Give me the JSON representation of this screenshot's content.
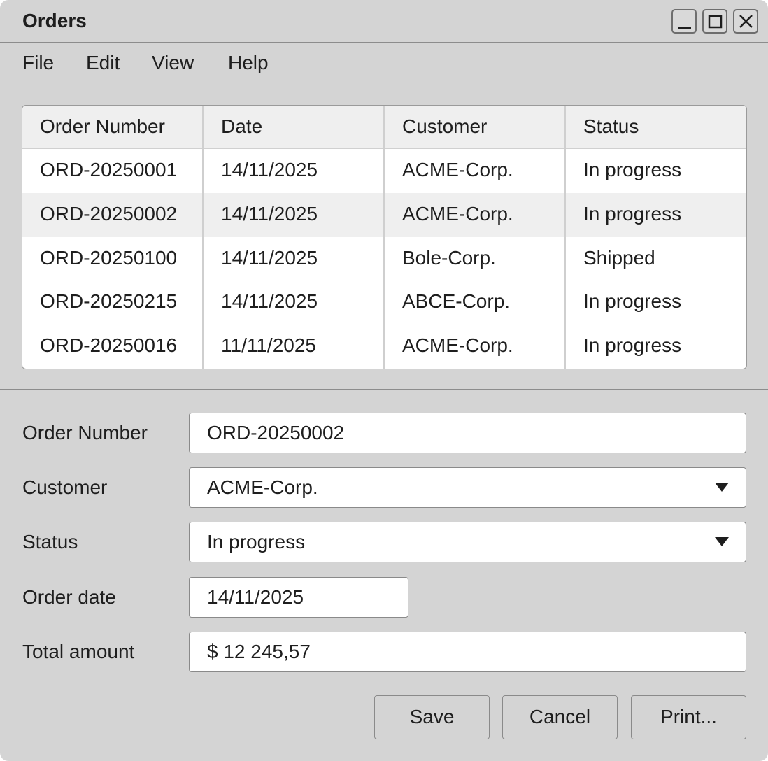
{
  "window": {
    "title": "Orders",
    "controls": [
      "minimize",
      "maximize",
      "close"
    ]
  },
  "menu": {
    "items": [
      "File",
      "Edit",
      "View",
      "Help"
    ]
  },
  "table": {
    "columns": [
      "Order Number",
      "Date",
      "Customer",
      "Status"
    ],
    "rows": [
      [
        "ORD-20250001",
        "14/11/2025",
        "ACME-Corp.",
        "In progress"
      ],
      [
        "ORD-20250002",
        "14/11/2025",
        "ACME-Corp.",
        "In progress"
      ],
      [
        "ORD-20250100",
        "14/11/2025",
        "Bole-Corp.",
        "Shipped"
      ],
      [
        "ORD-20250215",
        "14/11/2025",
        "ABCE-Corp.",
        "In progress"
      ],
      [
        "ORD-20250016",
        "11/11/2025",
        "ACME-Corp.",
        "In progress"
      ]
    ],
    "selected_row": 1
  },
  "form": {
    "order_number": {
      "label": "Order Number",
      "value": "ORD-20250002"
    },
    "customer": {
      "label": "Customer",
      "value": "ACME-Corp."
    },
    "status": {
      "label": "Status",
      "value": "In progress"
    },
    "order_date": {
      "label": "Order date",
      "value": "14/11/2025"
    },
    "total_amount": {
      "label": "Total amount",
      "value": "$ 12 245,57"
    }
  },
  "buttons": {
    "save": "Save",
    "cancel": "Cancel",
    "print": "Print..."
  }
}
